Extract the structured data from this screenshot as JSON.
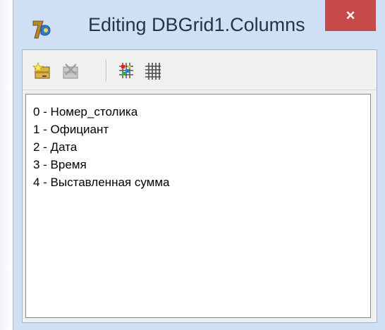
{
  "window": {
    "title": "Editing DBGrid1.Columns",
    "close_label": "×"
  },
  "toolbar": {
    "buttons": [
      {
        "name": "add-new-icon",
        "enabled": true
      },
      {
        "name": "delete-selected-icon",
        "enabled": false
      },
      {
        "name": "add-all-fields-icon",
        "enabled": true
      },
      {
        "name": "restore-defaults-icon",
        "enabled": true
      }
    ]
  },
  "columns": [
    "0 - Номер_столика",
    "1 - Официант",
    "2 - Дата",
    "3 - Время",
    "4 - Выставленная сумма"
  ],
  "colors": {
    "window_frame": "#cfe0f5",
    "close_button": "#c74a4a",
    "client_bg": "#f0f0f0",
    "list_bg": "#ffffff"
  }
}
